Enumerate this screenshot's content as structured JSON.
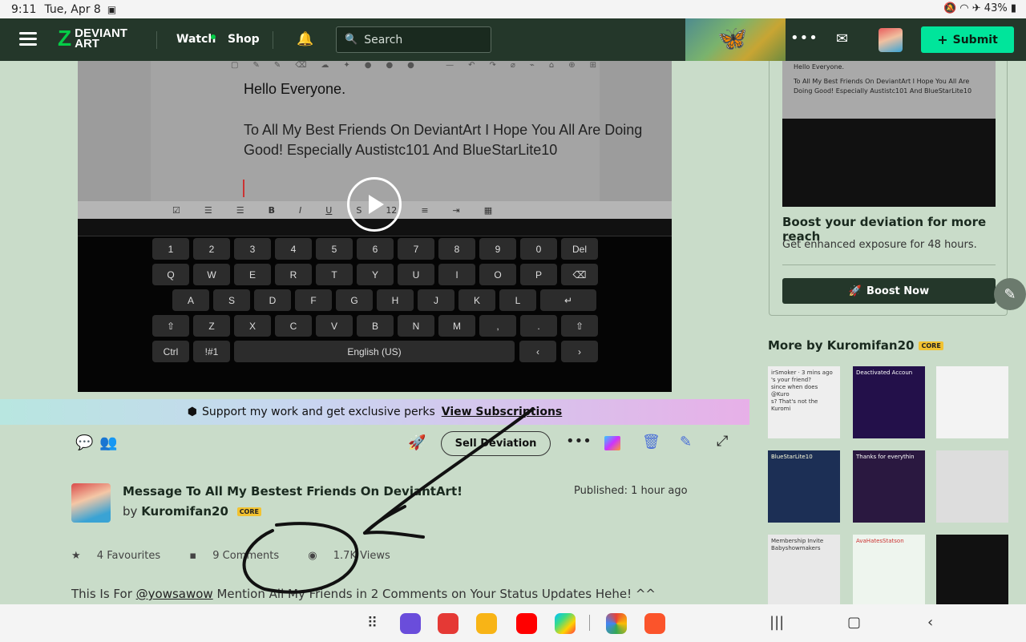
{
  "status_bar": {
    "time": "9:11",
    "date": "Tue, Apr 8",
    "battery": "43%"
  },
  "header": {
    "logo_line1": "DEVIANT",
    "logo_line2": "ART",
    "watch": "Watch",
    "shop": "Shop",
    "search_placeholder": "Search",
    "submit": "Submit"
  },
  "video": {
    "doc_heading": "Hello Everyone.",
    "doc_body": "To All My Best Friends On DeviantArt I Hope You All Are Doing Good! Especially Austistc101 And BlueStarLite10",
    "font_size": "12",
    "keyboard_rows": [
      [
        "1",
        "2",
        "3",
        "4",
        "5",
        "6",
        "7",
        "8",
        "9",
        "0",
        "Del"
      ],
      [
        "Q",
        "W",
        "E",
        "R",
        "T",
        "Y",
        "U",
        "I",
        "O",
        "P",
        "⌫"
      ],
      [
        "A",
        "S",
        "D",
        "F",
        "G",
        "H",
        "J",
        "K",
        "L",
        "↵"
      ],
      [
        "⇧",
        "Z",
        "X",
        "C",
        "V",
        "B",
        "N",
        "M",
        ",",
        ".",
        " ⇧"
      ],
      [
        "Ctrl",
        "!#1",
        "English (US)",
        "‹",
        "›"
      ]
    ]
  },
  "support_banner": {
    "text": "Support my work and get exclusive perks",
    "link": "View Subscriptions"
  },
  "actions": {
    "sell": "Sell Deviation"
  },
  "deviation": {
    "title": "Message To All My Bestest Friends On DeviantArt!",
    "by": "by",
    "author": "Kuromifan20",
    "badge": "CORE",
    "published": "Published: 1 hour ago",
    "favourites": "4 Favourites",
    "comments": "9 Comments",
    "views": "1.7K Views",
    "description_pre": "This Is For ",
    "description_mention": "@yowsawow",
    "description_post": " Mention All My Friends in 2 Comments on Your Status Updates Hehe! ^^"
  },
  "sidebar": {
    "thumb_line1": "Hello Everyone.",
    "thumb_line2": "To All My Best Friends On DeviantArt I Hope You All Are Doing Good! Especially Austistc101 And BlueStarLite10",
    "boost_heading": "Boost your deviation for more reach",
    "boost_text": "Get enhanced exposure for 48 hours.",
    "boost_button": "Boost Now",
    "more_by": "More by Kuromifan20",
    "more_badge": "CORE",
    "thumbs": [
      {
        "text": "irSmoker · 3 mins ago\n's your friend?\nsince when does @Kuro\ns? That's not the Kuromi"
      },
      {
        "text": "Deactivated Accoun"
      },
      {
        "text": ""
      },
      {
        "text": "BlueStarLite10"
      },
      {
        "text": "Thanks for everythin"
      },
      {
        "text": ""
      },
      {
        "text": "Membership Invite\nBabyshowmakers"
      },
      {
        "text": "AvaHatesStatson"
      },
      {
        "text": ""
      }
    ]
  }
}
